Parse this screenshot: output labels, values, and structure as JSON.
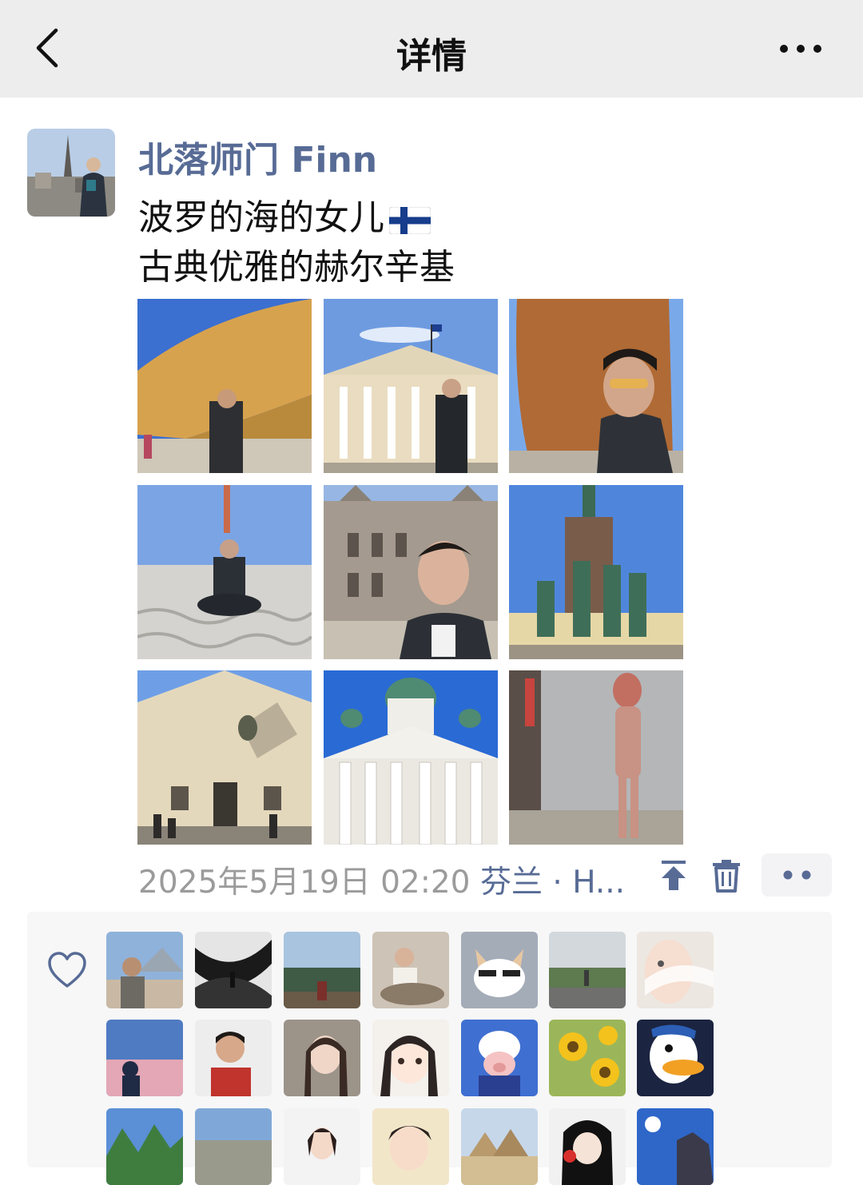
{
  "navbar": {
    "title": "详情",
    "back_icon": "chevron-left-icon",
    "more_icon": "ellipsis-icon"
  },
  "post": {
    "author": "北落师门 Finn",
    "text_lines": [
      "波罗的海的女儿",
      "古典优雅的赫尔辛基"
    ],
    "emoji": "finland-flag",
    "photos_count": 9,
    "timestamp": "2025年5月19日 02:20",
    "location": "芬兰 · H..."
  },
  "actions": {
    "pin_icon": "pin-top-icon",
    "delete_icon": "trash-icon",
    "more_icon": "two-dots-icon"
  },
  "likes": {
    "icon": "heart-outline-icon"
  },
  "colors": {
    "navbar_bg": "#ededed",
    "link_blue": "#576b95",
    "meta_gray": "#9b9b9b",
    "likes_bg": "#f7f7f7"
  }
}
